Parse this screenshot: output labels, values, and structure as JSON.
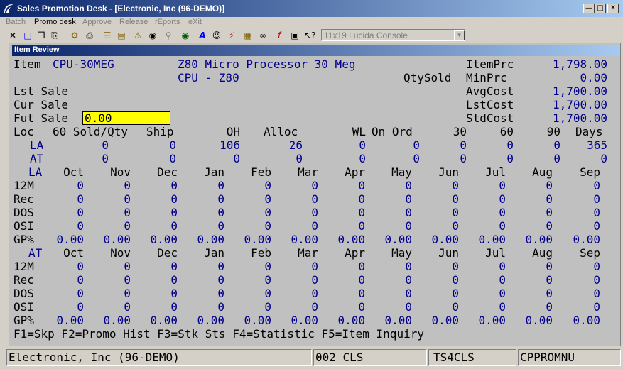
{
  "window": {
    "title": "Sales Promotion Desk - [Electronic, Inc (96-DEMO)]"
  },
  "menu": [
    {
      "label": "Batch",
      "enabled": false
    },
    {
      "label": "Promo desk",
      "enabled": true
    },
    {
      "label": "Approve",
      "enabled": false
    },
    {
      "label": "Release",
      "enabled": false
    },
    {
      "label": "rEports",
      "enabled": false
    },
    {
      "label": "eXit",
      "enabled": false
    }
  ],
  "toolbar": {
    "font_combo": "11x19 Lucida Console"
  },
  "item_review": {
    "title": "Item Review",
    "item_label": "Item",
    "item_code": "CPU-30MEG",
    "desc1": "Z80 Micro Processor 30 Meg",
    "desc2": "CPU - Z80",
    "qtysold_label": "QtySold",
    "itemprc_label": "ItemPrc",
    "itemprc": "1,798.00",
    "minprc_label": "MinPrc",
    "minprc": "0.00",
    "avgcost_label": "AvgCost",
    "avgcost": "1,700.00",
    "lstcost_label": "LstCost",
    "lstcost": "1,700.00",
    "stdcost_label": "StdCost",
    "stdcost": "1,700.00",
    "lst_sale_label": "Lst Sale",
    "cur_sale_label": "Cur Sale",
    "fut_sale_label": "Fut Sale",
    "fut_sale_value": "0.00",
    "loc_header": {
      "loc": "Loc",
      "sold": "60 Sold/Qty",
      "ship": "Ship",
      "oh": "OH",
      "alloc": "Alloc",
      "wl": "WL",
      "on_ord": "On Ord",
      "d30": "30",
      "d60": "60",
      "d90": "90",
      "days": "Days"
    },
    "loc_rows": [
      {
        "loc": "LA",
        "sold": "0",
        "ship": "0",
        "oh": "106",
        "alloc": "26",
        "wl": "0",
        "on_ord": "0",
        "d30": "0",
        "d60": "0",
        "d90": "0",
        "days": "365"
      },
      {
        "loc": "AT",
        "sold": "0",
        "ship": "0",
        "oh": "0",
        "alloc": "0",
        "wl": "0",
        "on_ord": "0",
        "d30": "0",
        "d60": "0",
        "d90": "0",
        "days": "0"
      }
    ],
    "months": [
      "Oct",
      "Nov",
      "Dec",
      "Jan",
      "Feb",
      "Mar",
      "Apr",
      "May",
      "Jun",
      "Jul",
      "Aug",
      "Sep"
    ],
    "sections": [
      {
        "loc": "LA",
        "rows": [
          {
            "label": "12M",
            "values": [
              "0",
              "0",
              "0",
              "0",
              "0",
              "0",
              "0",
              "0",
              "0",
              "0",
              "0",
              "0"
            ]
          },
          {
            "label": "Rec",
            "values": [
              "0",
              "0",
              "0",
              "0",
              "0",
              "0",
              "0",
              "0",
              "0",
              "0",
              "0",
              "0"
            ]
          },
          {
            "label": "DOS",
            "values": [
              "0",
              "0",
              "0",
              "0",
              "0",
              "0",
              "0",
              "0",
              "0",
              "0",
              "0",
              "0"
            ]
          },
          {
            "label": "OSI",
            "values": [
              "0",
              "0",
              "0",
              "0",
              "0",
              "0",
              "0",
              "0",
              "0",
              "0",
              "0",
              "0"
            ]
          },
          {
            "label": "GP%",
            "values": [
              "0.00",
              "0.00",
              "0.00",
              "0.00",
              "0.00",
              "0.00",
              "0.00",
              "0.00",
              "0.00",
              "0.00",
              "0.00",
              "0.00"
            ]
          }
        ]
      },
      {
        "loc": "AT",
        "rows": [
          {
            "label": "12M",
            "values": [
              "0",
              "0",
              "0",
              "0",
              "0",
              "0",
              "0",
              "0",
              "0",
              "0",
              "0",
              "0"
            ]
          },
          {
            "label": "Rec",
            "values": [
              "0",
              "0",
              "0",
              "0",
              "0",
              "0",
              "0",
              "0",
              "0",
              "0",
              "0",
              "0"
            ]
          },
          {
            "label": "DOS",
            "values": [
              "0",
              "0",
              "0",
              "0",
              "0",
              "0",
              "0",
              "0",
              "0",
              "0",
              "0",
              "0"
            ]
          },
          {
            "label": "OSI",
            "values": [
              "0",
              "0",
              "0",
              "0",
              "0",
              "0",
              "0",
              "0",
              "0",
              "0",
              "0",
              "0"
            ]
          },
          {
            "label": "GP%",
            "values": [
              "0.00",
              "0.00",
              "0.00",
              "0.00",
              "0.00",
              "0.00",
              "0.00",
              "0.00",
              "0.00",
              "0.00",
              "0.00",
              "0.00"
            ]
          }
        ]
      }
    ],
    "function_keys": "F1=Skp F2=Promo Hist F3=Stk Sts F4=Statistic F5=Item Inquiry"
  },
  "statusbar": {
    "company": "Electronic, Inc (96-DEMO)",
    "code": "002 CLS",
    "station": "TS4CLS",
    "program": "CPPROMNU"
  }
}
